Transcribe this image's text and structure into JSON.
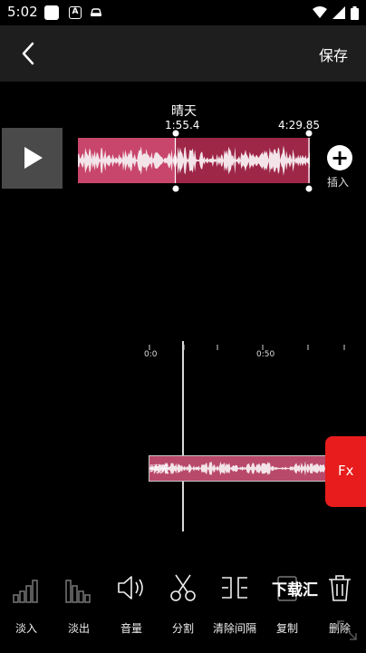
{
  "status": {
    "time": "5:02",
    "a_icon": "A",
    "icons": [
      "white-square-icon",
      "a-box-icon",
      "car-icon",
      "wifi-icon",
      "signal-icon",
      "battery-icon"
    ]
  },
  "toolbar": {
    "back_icon": "chevron-left-icon",
    "save_label": "保存"
  },
  "track": {
    "title": "晴天",
    "start_time": "1:55.4",
    "end_time": "4:29.85",
    "selection_start_fraction": 0.42,
    "selection_end_fraction": 1.0
  },
  "insert": {
    "label": "插入",
    "icon": "plus-icon"
  },
  "timeline": {
    "tick_labels": [
      "0:0",
      "0:50"
    ],
    "clip_label": "晴天"
  },
  "fx": {
    "label": "Fx"
  },
  "tools": [
    {
      "label": "淡入",
      "icon": "fade-in-icon"
    },
    {
      "label": "淡出",
      "icon": "fade-out-icon"
    },
    {
      "label": "音量",
      "icon": "volume-icon"
    },
    {
      "label": "分割",
      "icon": "scissors-icon"
    },
    {
      "label": "清除间隔",
      "icon": "clear-gap-icon"
    },
    {
      "label": "复制",
      "icon": "copy-icon"
    },
    {
      "label": "删除",
      "icon": "trash-icon"
    }
  ],
  "watermark": "下载汇",
  "colors": {
    "waveform_bg": "#c8466c",
    "waveform_selected": "#8e1c3a",
    "waveform_line": "#f3e4e9",
    "fx_red": "#e81c1c",
    "toolbar_bg": "#1e1e1e"
  }
}
